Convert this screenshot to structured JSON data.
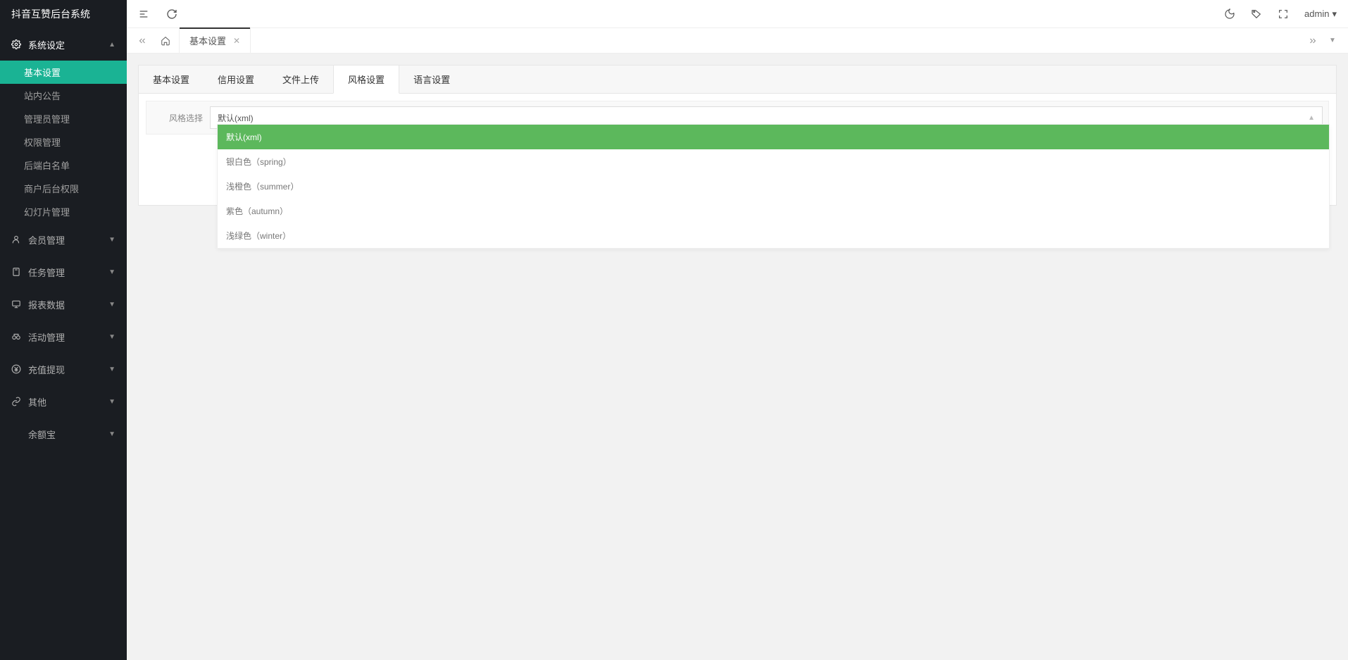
{
  "brand": "抖音互赞后台系统",
  "user": {
    "name": "admin"
  },
  "sidebar": {
    "groups": [
      {
        "label": "系统设定",
        "expanded": true,
        "items": [
          {
            "label": "基本设置",
            "active": true
          },
          {
            "label": "站内公告"
          },
          {
            "label": "管理员管理"
          },
          {
            "label": "权限管理"
          },
          {
            "label": "后端白名单"
          },
          {
            "label": "商户后台权限"
          },
          {
            "label": "幻灯片管理"
          }
        ]
      },
      {
        "label": "会员管理",
        "expanded": false
      },
      {
        "label": "任务管理",
        "expanded": false
      },
      {
        "label": "报表数据",
        "expanded": false
      },
      {
        "label": "活动管理",
        "expanded": false
      },
      {
        "label": "充值提现",
        "expanded": false
      },
      {
        "label": "其他",
        "expanded": false
      },
      {
        "label": "余额宝",
        "expanded": false
      }
    ]
  },
  "tabs": {
    "active": {
      "label": "基本设置"
    }
  },
  "panel": {
    "tabs": [
      {
        "label": "基本设置"
      },
      {
        "label": "信用设置"
      },
      {
        "label": "文件上传"
      },
      {
        "label": "风格设置",
        "active": true
      },
      {
        "label": "语言设置"
      }
    ],
    "form": {
      "style_label": "风格选择",
      "style_value": "默认(xml)",
      "style_options": [
        {
          "label": "默认(xml)",
          "selected": true
        },
        {
          "label": "银白色（spring）"
        },
        {
          "label": "浅橙色（summer）"
        },
        {
          "label": "紫色（autumn）"
        },
        {
          "label": "浅绿色（winter）"
        }
      ]
    }
  }
}
